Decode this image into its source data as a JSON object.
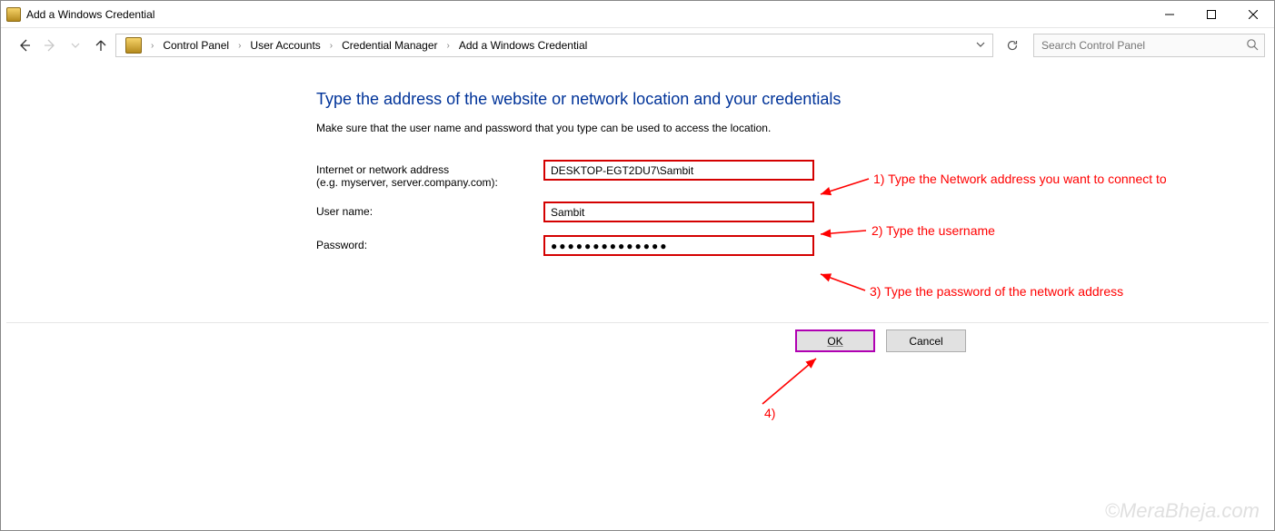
{
  "window": {
    "title": "Add a Windows Credential"
  },
  "breadcrumb": {
    "items": [
      "Control Panel",
      "User Accounts",
      "Credential Manager",
      "Add a Windows Credential"
    ]
  },
  "search": {
    "placeholder": "Search Control Panel"
  },
  "page": {
    "heading": "Type the address of the website or network location and your credentials",
    "subtext": "Make sure that the user name and password that you type can be used to access the location."
  },
  "form": {
    "address": {
      "label": "Internet or network address",
      "hint": "(e.g. myserver, server.company.com):",
      "value": "DESKTOP-EGT2DU7\\Sambit"
    },
    "username": {
      "label": "User name:",
      "value": "Sambit"
    },
    "password": {
      "label": "Password:",
      "value": "●●●●●●●●●●●●●●"
    }
  },
  "buttons": {
    "ok": "OK",
    "cancel": "Cancel"
  },
  "annotations": {
    "a1": "1) Type the Network address you want to connect to",
    "a2": "2) Type the username",
    "a3": "3) Type the password of the network address",
    "a4": "4)"
  },
  "watermark": "©MeraBheja.com",
  "colors": {
    "heading": "#003399",
    "anno": "#ff0000",
    "highlight": "#d40000",
    "ok_border": "#b000b2"
  }
}
